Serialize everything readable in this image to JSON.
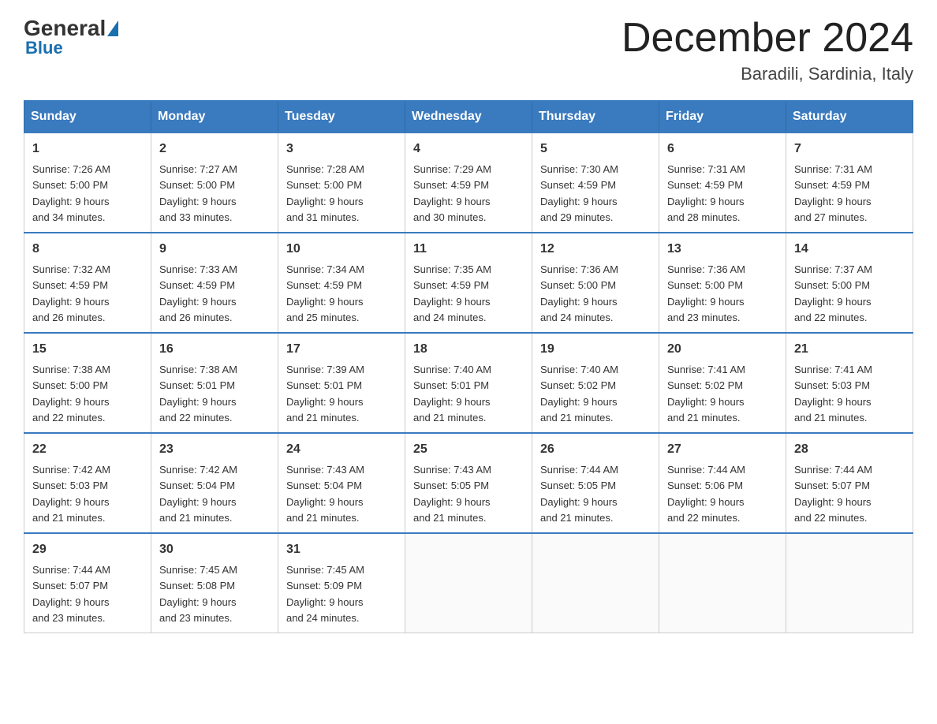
{
  "header": {
    "logo_general": "General",
    "logo_blue": "Blue",
    "month_title": "December 2024",
    "location": "Baradili, Sardinia, Italy"
  },
  "days_of_week": [
    "Sunday",
    "Monday",
    "Tuesday",
    "Wednesday",
    "Thursday",
    "Friday",
    "Saturday"
  ],
  "weeks": [
    [
      {
        "day": "1",
        "sunrise": "7:26 AM",
        "sunset": "5:00 PM",
        "daylight": "9 hours and 34 minutes."
      },
      {
        "day": "2",
        "sunrise": "7:27 AM",
        "sunset": "5:00 PM",
        "daylight": "9 hours and 33 minutes."
      },
      {
        "day": "3",
        "sunrise": "7:28 AM",
        "sunset": "5:00 PM",
        "daylight": "9 hours and 31 minutes."
      },
      {
        "day": "4",
        "sunrise": "7:29 AM",
        "sunset": "4:59 PM",
        "daylight": "9 hours and 30 minutes."
      },
      {
        "day": "5",
        "sunrise": "7:30 AM",
        "sunset": "4:59 PM",
        "daylight": "9 hours and 29 minutes."
      },
      {
        "day": "6",
        "sunrise": "7:31 AM",
        "sunset": "4:59 PM",
        "daylight": "9 hours and 28 minutes."
      },
      {
        "day": "7",
        "sunrise": "7:31 AM",
        "sunset": "4:59 PM",
        "daylight": "9 hours and 27 minutes."
      }
    ],
    [
      {
        "day": "8",
        "sunrise": "7:32 AM",
        "sunset": "4:59 PM",
        "daylight": "9 hours and 26 minutes."
      },
      {
        "day": "9",
        "sunrise": "7:33 AM",
        "sunset": "4:59 PM",
        "daylight": "9 hours and 26 minutes."
      },
      {
        "day": "10",
        "sunrise": "7:34 AM",
        "sunset": "4:59 PM",
        "daylight": "9 hours and 25 minutes."
      },
      {
        "day": "11",
        "sunrise": "7:35 AM",
        "sunset": "4:59 PM",
        "daylight": "9 hours and 24 minutes."
      },
      {
        "day": "12",
        "sunrise": "7:36 AM",
        "sunset": "5:00 PM",
        "daylight": "9 hours and 24 minutes."
      },
      {
        "day": "13",
        "sunrise": "7:36 AM",
        "sunset": "5:00 PM",
        "daylight": "9 hours and 23 minutes."
      },
      {
        "day": "14",
        "sunrise": "7:37 AM",
        "sunset": "5:00 PM",
        "daylight": "9 hours and 22 minutes."
      }
    ],
    [
      {
        "day": "15",
        "sunrise": "7:38 AM",
        "sunset": "5:00 PM",
        "daylight": "9 hours and 22 minutes."
      },
      {
        "day": "16",
        "sunrise": "7:38 AM",
        "sunset": "5:01 PM",
        "daylight": "9 hours and 22 minutes."
      },
      {
        "day": "17",
        "sunrise": "7:39 AM",
        "sunset": "5:01 PM",
        "daylight": "9 hours and 21 minutes."
      },
      {
        "day": "18",
        "sunrise": "7:40 AM",
        "sunset": "5:01 PM",
        "daylight": "9 hours and 21 minutes."
      },
      {
        "day": "19",
        "sunrise": "7:40 AM",
        "sunset": "5:02 PM",
        "daylight": "9 hours and 21 minutes."
      },
      {
        "day": "20",
        "sunrise": "7:41 AM",
        "sunset": "5:02 PM",
        "daylight": "9 hours and 21 minutes."
      },
      {
        "day": "21",
        "sunrise": "7:41 AM",
        "sunset": "5:03 PM",
        "daylight": "9 hours and 21 minutes."
      }
    ],
    [
      {
        "day": "22",
        "sunrise": "7:42 AM",
        "sunset": "5:03 PM",
        "daylight": "9 hours and 21 minutes."
      },
      {
        "day": "23",
        "sunrise": "7:42 AM",
        "sunset": "5:04 PM",
        "daylight": "9 hours and 21 minutes."
      },
      {
        "day": "24",
        "sunrise": "7:43 AM",
        "sunset": "5:04 PM",
        "daylight": "9 hours and 21 minutes."
      },
      {
        "day": "25",
        "sunrise": "7:43 AM",
        "sunset": "5:05 PM",
        "daylight": "9 hours and 21 minutes."
      },
      {
        "day": "26",
        "sunrise": "7:44 AM",
        "sunset": "5:05 PM",
        "daylight": "9 hours and 21 minutes."
      },
      {
        "day": "27",
        "sunrise": "7:44 AM",
        "sunset": "5:06 PM",
        "daylight": "9 hours and 22 minutes."
      },
      {
        "day": "28",
        "sunrise": "7:44 AM",
        "sunset": "5:07 PM",
        "daylight": "9 hours and 22 minutes."
      }
    ],
    [
      {
        "day": "29",
        "sunrise": "7:44 AM",
        "sunset": "5:07 PM",
        "daylight": "9 hours and 23 minutes."
      },
      {
        "day": "30",
        "sunrise": "7:45 AM",
        "sunset": "5:08 PM",
        "daylight": "9 hours and 23 minutes."
      },
      {
        "day": "31",
        "sunrise": "7:45 AM",
        "sunset": "5:09 PM",
        "daylight": "9 hours and 24 minutes."
      },
      null,
      null,
      null,
      null
    ]
  ],
  "labels": {
    "sunrise": "Sunrise:",
    "sunset": "Sunset:",
    "daylight": "Daylight:"
  }
}
